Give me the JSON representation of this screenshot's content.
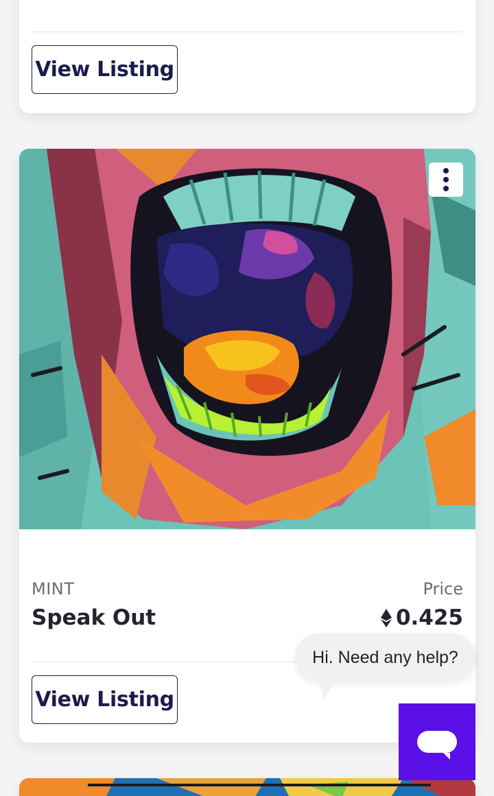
{
  "top_card": {
    "button_label": "View Listing"
  },
  "listing": {
    "collection": "MINT",
    "title": "Speak Out",
    "price_label": "Price",
    "price_value": "0.425",
    "currency_icon": "ethereum-icon",
    "button_label": "View Listing",
    "image_alt": "Pop-art painting of an open screaming mouth with colorful tongue and teeth"
  },
  "chat": {
    "greeting": "Hi. Need any help?",
    "button_icon": "chat-bubble-icon",
    "accent_color": "#5b10e8"
  },
  "colors": {
    "button_text": "#1d1b4c",
    "muted_text": "#6b6b73",
    "primary_text": "#25242e"
  }
}
